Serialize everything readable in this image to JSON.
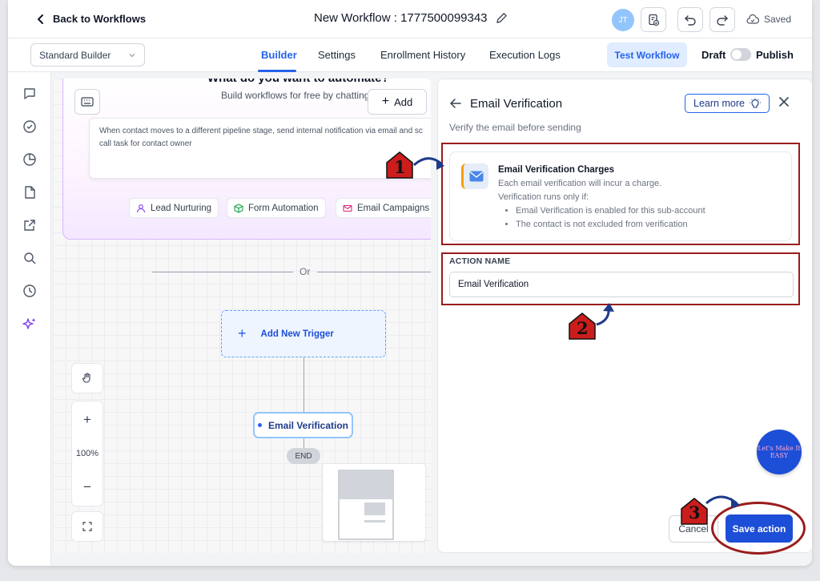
{
  "header": {
    "back_label": "Back to Workflows",
    "workflow_title": "New Workflow : 1777500099343",
    "avatar_initials": "JT",
    "saved_label": "Saved"
  },
  "subnav": {
    "builder_mode": "Standard Builder",
    "tabs": [
      {
        "label": "Builder",
        "active": true
      },
      {
        "label": "Settings",
        "active": false
      },
      {
        "label": "Enrollment History",
        "active": false
      },
      {
        "label": "Execution Logs",
        "active": false
      }
    ],
    "test_workflow": "Test Workflow",
    "draft_label": "Draft",
    "publish_label": "Publish"
  },
  "canvas": {
    "ai_title": "What do you want to automate?",
    "ai_subtitle": "Build workflows for free by chatting",
    "add_label": "Add",
    "prompt_text": "When contact moves to a different pipeline stage, send internal notification via email and sc call task for contact owner",
    "chips": [
      "Lead Nurturing",
      "Form Automation",
      "Email Campaigns"
    ],
    "or_label": "Or",
    "add_trigger": "Add New Trigger",
    "node_label": "Email Verification",
    "end_label": "END",
    "zoom_level": "100%"
  },
  "panel": {
    "title": "Email Verification",
    "learn_more": "Learn more",
    "subtitle": "Verify the email before sending",
    "charges_title": "Email Verification Charges",
    "charges_line1": "Each email verification will incur a charge.",
    "charges_line2": "Verification runs only if:",
    "charges_bullets": [
      "Email Verification is enabled for this sub-account",
      "The contact is not excluded from verification"
    ],
    "action_name_label": "ACTION NAME",
    "action_name_value": "Email Verification",
    "cancel_label": "Cancel",
    "save_label": "Save action"
  },
  "badge": {
    "text": "Let's Make It EASY"
  },
  "annotations": {
    "step1": "1",
    "step2": "2",
    "step3": "3",
    "color": "#9b1c1c"
  },
  "colors": {
    "accent": "#2563eb",
    "save_button": "#1d4ed8",
    "canvas_card_border": "#d8b4fe"
  }
}
